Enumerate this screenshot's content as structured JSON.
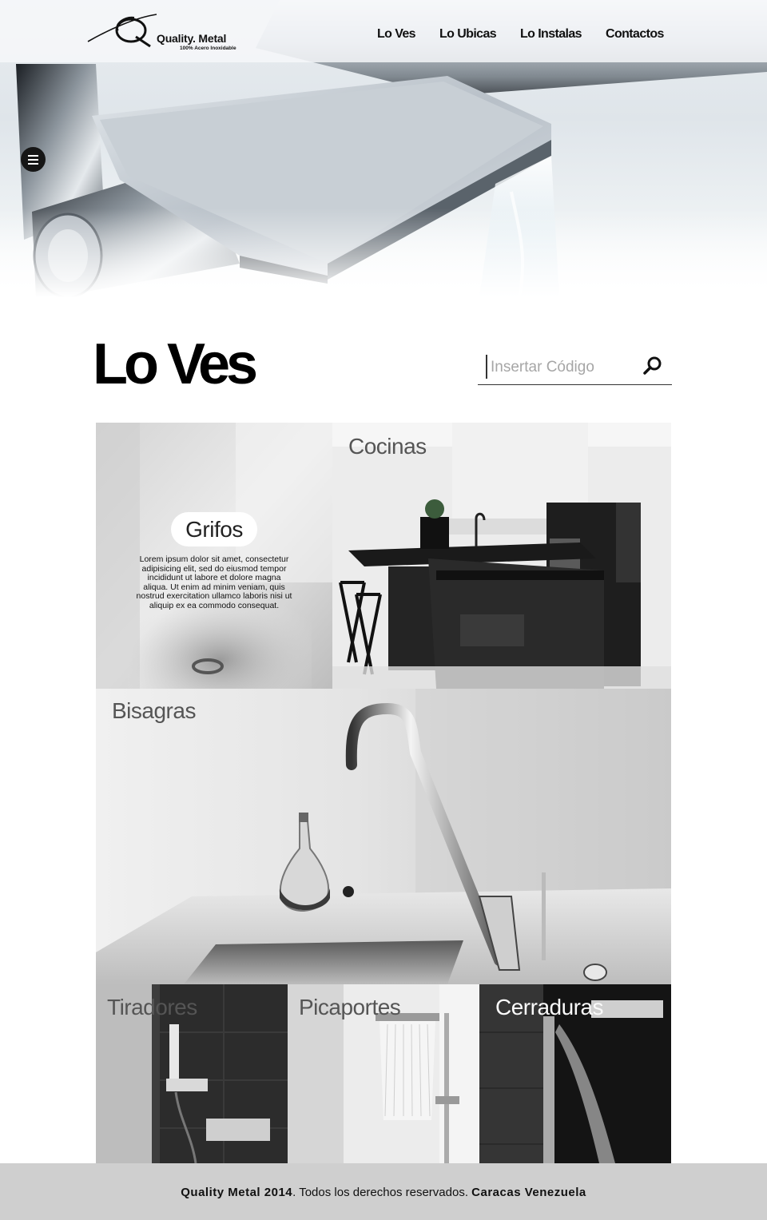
{
  "header": {
    "logo": {
      "name": "Quality. Metal",
      "tagline": "100% Acero Inoxidable"
    },
    "nav": [
      {
        "label": "Lo Ves"
      },
      {
        "label": "Lo Ubicas"
      },
      {
        "label": "Lo Instalas"
      },
      {
        "label": "Contactos"
      }
    ],
    "menu_icon": "hamburger-menu-icon"
  },
  "main": {
    "title": "Lo Ves",
    "search": {
      "placeholder": "Insertar Código",
      "icon": "search-icon"
    },
    "tiles": {
      "grifos": {
        "label": "Grifos",
        "description": "Lorem ipsum dolor sit amet, consectetur adipisicing elit, sed do eiusmod tempor incididunt ut labore et dolore magna aliqua. Ut enim ad minim veniam, quis nostrud exercitation ullamco laboris nisi ut aliquip ex ea commodo consequat."
      },
      "cocinas": {
        "label": "Cocinas"
      },
      "bisagras": {
        "label": "Bisagras"
      },
      "tiradores": {
        "label": "Tiradores"
      },
      "picaportes": {
        "label": "Picaportes"
      },
      "cerraduras": {
        "label": "Cerraduras"
      }
    }
  },
  "footer": {
    "brand": "Quality Metal 2014",
    "rights": ". Todos los derechos reservados. ",
    "location": "Caracas Venezuela"
  },
  "colors": {
    "text": "#111111",
    "footer_bg": "#c8c8c8",
    "menu_button": "#161616"
  }
}
